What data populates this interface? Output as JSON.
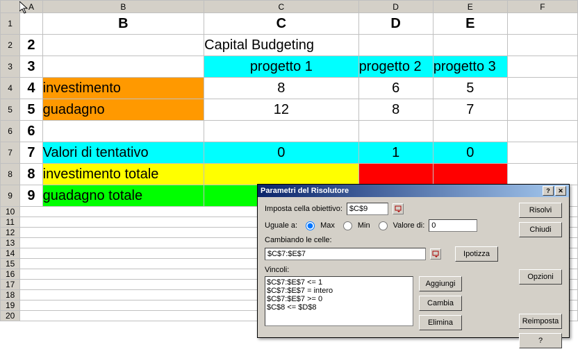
{
  "columns": [
    "A",
    "B",
    "C",
    "D",
    "E",
    "F"
  ],
  "rows": [
    "1",
    "2",
    "3",
    "4",
    "5",
    "6",
    "7",
    "8",
    "9",
    "10",
    "11",
    "12",
    "13",
    "14",
    "15",
    "16",
    "17",
    "18",
    "19",
    "20"
  ],
  "header": {
    "b": "B",
    "c": "C",
    "d": "D",
    "e": "E"
  },
  "r2": {
    "a": "2",
    "c": "Capital Budgeting"
  },
  "r3": {
    "a": "3",
    "c": "progetto 1",
    "d": "progetto 2",
    "e": "progetto 3"
  },
  "r4": {
    "a": "4",
    "b": "investimento",
    "c": "8",
    "d": "6",
    "e": "5"
  },
  "r5": {
    "a": "5",
    "b": "guadagno",
    "c": "12",
    "d": "8",
    "e": "7"
  },
  "r6": {
    "a": "6"
  },
  "r7": {
    "a": "7",
    "b": "Valori di tentativo",
    "c": "0",
    "d": "1",
    "e": "0"
  },
  "r8": {
    "a": "8",
    "b": "investimento totale"
  },
  "r9": {
    "a": "9",
    "b": "guadagno totale"
  },
  "dialog": {
    "title": "Parametri del Risolutore",
    "target_label": "Imposta cella obiettivo:",
    "target_value": "$C$9",
    "equal_label": "Uguale a:",
    "opt_max": "Max",
    "opt_min": "Min",
    "opt_val": "Valore di:",
    "val_value": "0",
    "changing_label": "Cambiando le celle:",
    "changing_value": "$C$7:$E$7",
    "constraints_label": "Vincoli:",
    "constraints": [
      "$C$7:$E$7 <= 1",
      "$C$7:$E$7 = intero",
      "$C$7:$E$7 >= 0",
      "$C$8 <= $D$8"
    ],
    "btn_solve": "Risolvi",
    "btn_close": "Chiudi",
    "btn_guess": "Ipotizza",
    "btn_options": "Opzioni",
    "btn_add": "Aggiungi",
    "btn_change": "Cambia",
    "btn_delete": "Elimina",
    "btn_reset": "Reimposta",
    "btn_help": "?"
  }
}
